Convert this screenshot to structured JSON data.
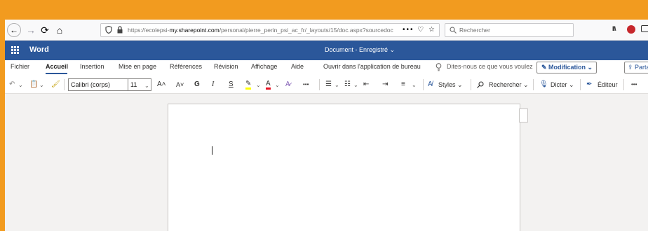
{
  "browser": {
    "url_prefix": "https://ecolepsi-",
    "url_domain": "my.sharepoint.com",
    "url_rest": "/personal/pierre_perin_psi_ac_fr/_layouts/15/doc.aspx?sourcedoc",
    "url_tools": "••• ♡ ☆",
    "search_placeholder": "Rechercher"
  },
  "header": {
    "app_name": "Word",
    "doc_status": "Document - Enregistré ⌄"
  },
  "tabs": [
    {
      "label": "Fichier"
    },
    {
      "label": "Accueil"
    },
    {
      "label": "Insertion"
    },
    {
      "label": "Mise en page"
    },
    {
      "label": "Références"
    },
    {
      "label": "Révision"
    },
    {
      "label": "Affichage"
    },
    {
      "label": "Aide"
    },
    {
      "label": "Ouvrir dans l'application de bureau"
    }
  ],
  "tell_me": "Dites-nous ce que vous voulez",
  "mode_button": "✎ Modification ⌄",
  "share_button": "⇪ Partager",
  "toolbar": {
    "font_name": "Calibri (corps)",
    "font_size": "11",
    "grow": "A˄",
    "shrink": "A˅",
    "bold": "G",
    "italic": "I",
    "underline": "S",
    "more": "•••",
    "styles": "Styles ⌄",
    "find": "Rechercher ⌄",
    "dictate": "Dicter ⌄",
    "editor": "Éditeur",
    "overflow": "•••"
  },
  "colors": {
    "accent": "#2b579a",
    "background_border": "#f29b1f"
  }
}
